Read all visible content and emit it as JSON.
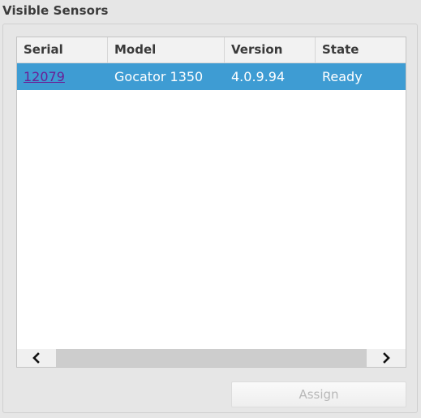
{
  "panel": {
    "title": "Visible Sensors"
  },
  "table": {
    "columns": [
      "Serial",
      "Model",
      "Version",
      "State"
    ],
    "rows": [
      {
        "serial": "12079",
        "model": "Gocator 1350",
        "version": "4.0.9.94",
        "state": "Ready",
        "selected": true
      }
    ]
  },
  "scrollbar": {
    "left_icon": "chevron-left-icon",
    "right_icon": "chevron-right-icon"
  },
  "actions": {
    "assign_label": "Assign",
    "assign_enabled": false
  },
  "colors": {
    "selection": "#3e9cd3",
    "link": "#6a1f96",
    "background": "#e6e6e6"
  }
}
